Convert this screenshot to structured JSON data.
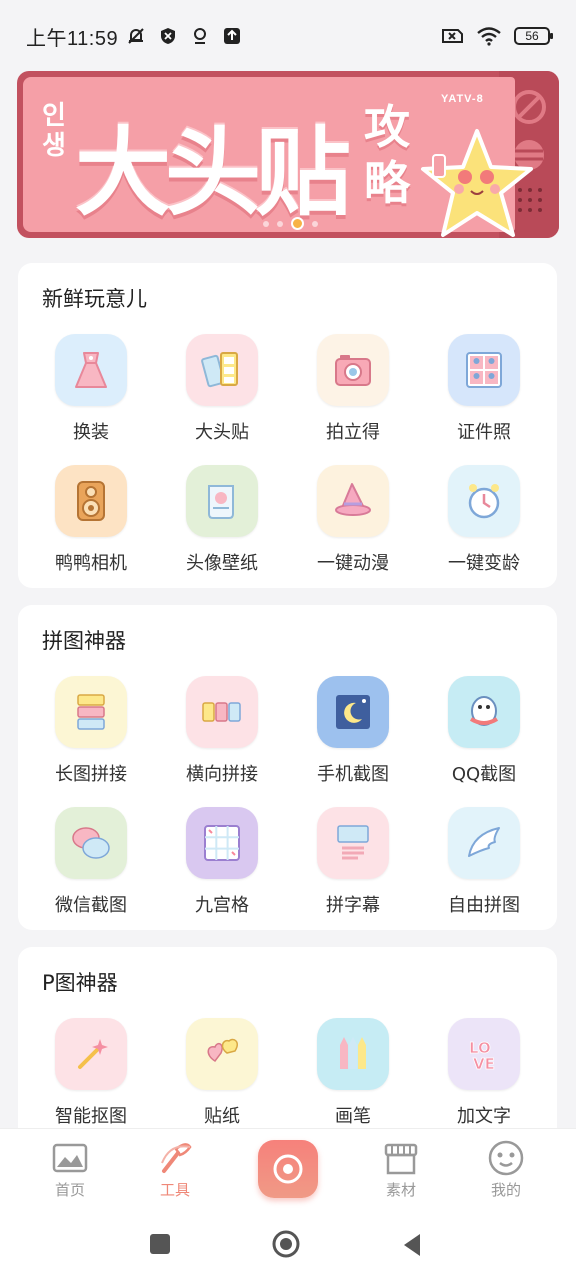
{
  "status_bar": {
    "time": "上午11:59",
    "battery": "56"
  },
  "banner": {
    "korean": "인생",
    "title": "大头贴",
    "subtitle": "攻略",
    "tag": "YATV-8",
    "colors": {
      "bg": "#f59fa7",
      "frame": "#c2515f"
    },
    "page_dots": 4,
    "active_dot": 3
  },
  "sections": [
    {
      "title": "新鲜玩意儿",
      "tools": [
        {
          "label": "换装",
          "icon": "dress-icon"
        },
        {
          "label": "大头贴",
          "icon": "photo-strip-icon"
        },
        {
          "label": "拍立得",
          "icon": "instant-camera-icon"
        },
        {
          "label": "证件照",
          "icon": "id-photo-icon"
        },
        {
          "label": "鸭鸭相机",
          "icon": "retro-camera-icon"
        },
        {
          "label": "头像壁纸",
          "icon": "scroll-icon"
        },
        {
          "label": "一键动漫",
          "icon": "witch-hat-icon"
        },
        {
          "label": "一键变龄",
          "icon": "alarm-clock-icon"
        }
      ]
    },
    {
      "title": "拼图神器",
      "tools": [
        {
          "label": "长图拼接",
          "icon": "long-stitch-icon"
        },
        {
          "label": "横向拼接",
          "icon": "horizontal-stitch-icon"
        },
        {
          "label": "手机截图",
          "icon": "moon-screenshot-icon"
        },
        {
          "label": "QQ截图",
          "icon": "penguin-icon"
        },
        {
          "label": "微信截图",
          "icon": "chat-bubbles-icon"
        },
        {
          "label": "九宫格",
          "icon": "nine-grid-icon"
        },
        {
          "label": "拼字幕",
          "icon": "subtitle-icon"
        },
        {
          "label": "自由拼图",
          "icon": "wing-icon"
        }
      ]
    },
    {
      "title": "P图神器",
      "tools": [
        {
          "label": "智能抠图",
          "icon": "magic-wand-icon"
        },
        {
          "label": "贴纸",
          "icon": "heart-sticker-icon"
        },
        {
          "label": "画笔",
          "icon": "crayons-icon"
        },
        {
          "label": "加文字",
          "icon": "love-text-icon"
        }
      ]
    }
  ],
  "bottom_nav": [
    {
      "label": "首页",
      "icon": "image-icon",
      "active": false
    },
    {
      "label": "工具",
      "icon": "brush-icon",
      "active": true
    },
    {
      "label": "",
      "icon": "camera-icon",
      "active": false
    },
    {
      "label": "素材",
      "icon": "shop-icon",
      "active": false
    },
    {
      "label": "我的",
      "icon": "face-icon",
      "active": false
    }
  ],
  "accent_color": "#ef8878"
}
